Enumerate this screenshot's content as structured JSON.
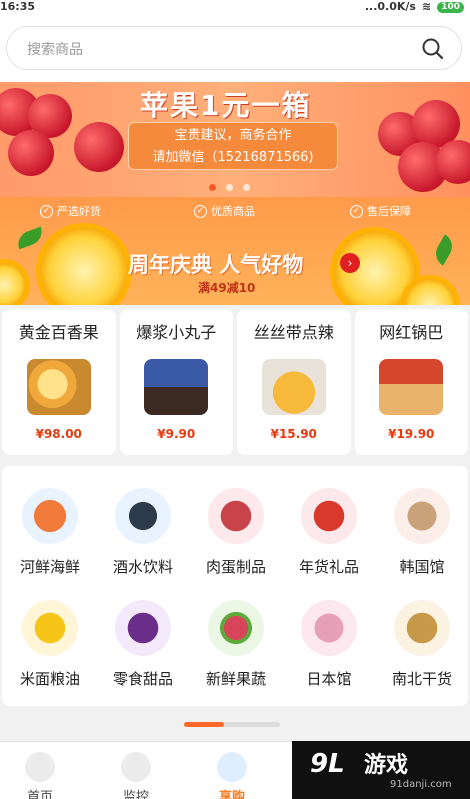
{
  "status_bar": {
    "time": "16:35",
    "network": "...0.0K/s",
    "battery": "100"
  },
  "search": {
    "placeholder": "搜索商品"
  },
  "banner": {
    "title": "苹果1元一箱",
    "line1": "宝贵建议，商务合作",
    "line2": "请加微信（15216871566)"
  },
  "guarantees": [
    "严选好货",
    "优质商品",
    "售后保障"
  ],
  "promo": {
    "headline": "周年庆典 人气好物",
    "sub": "满49减10"
  },
  "products": [
    {
      "name": "黄金百香果",
      "price": "¥98.00"
    },
    {
      "name": "爆浆小丸子",
      "price": "¥9.90"
    },
    {
      "name": "丝丝带点辣",
      "price": "¥15.90"
    },
    {
      "name": "网红锅巴",
      "price": "¥19.90"
    }
  ],
  "categories": [
    {
      "label": "河鲜海鲜"
    },
    {
      "label": "酒水饮料"
    },
    {
      "label": "肉蛋制品"
    },
    {
      "label": "年货礼品"
    },
    {
      "label": "韩国馆"
    },
    {
      "label": "米面粮油"
    },
    {
      "label": "零食甜品"
    },
    {
      "label": "新鲜果蔬"
    },
    {
      "label": "日本馆"
    },
    {
      "label": "南北干货"
    }
  ],
  "tabs": [
    {
      "label": "首页"
    },
    {
      "label": "监控"
    },
    {
      "label": "享购"
    }
  ],
  "watermark": {
    "logo": "9L",
    "title": "游戏",
    "domain": "91danji.com"
  },
  "colors": {
    "accent": "#ff7a1a",
    "price": "#e8380d",
    "promo_bg": "#ffa24f"
  }
}
